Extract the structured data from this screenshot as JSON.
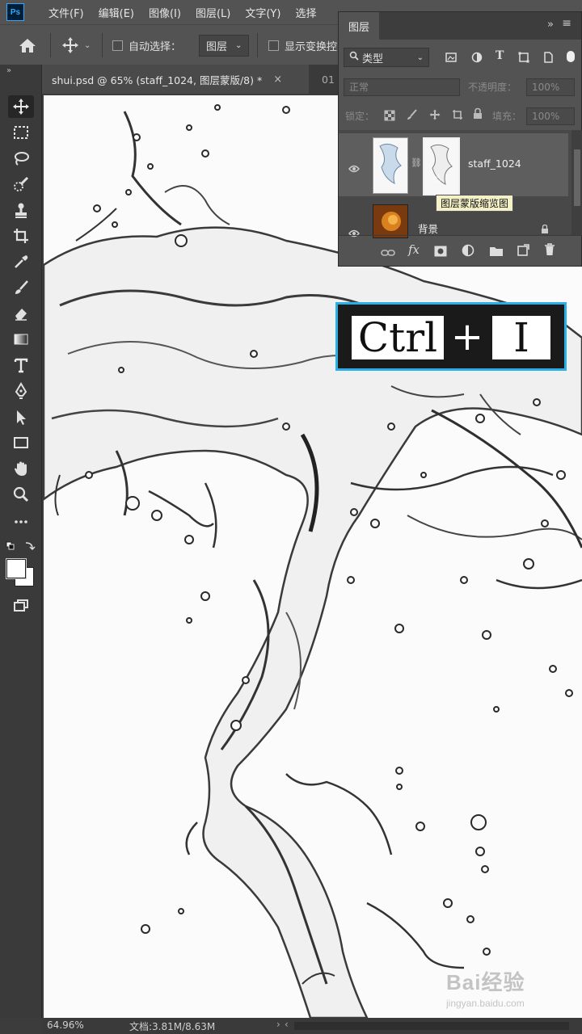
{
  "menubar": {
    "logo": "Ps",
    "items": [
      "文件(F)",
      "编辑(E)",
      "图像(I)",
      "图层(L)",
      "文字(Y)",
      "选择"
    ]
  },
  "options": {
    "auto_select_label": "自动选择：",
    "auto_select_value": "图层",
    "show_transform_label": "显示变换控"
  },
  "tabs": {
    "active_title": "shui.psd @ 65% (staff_1024, 图层蒙版/8) *",
    "close_glyph": "×",
    "second_title": "01"
  },
  "layers_panel": {
    "title": "图层",
    "filter_value": "类型",
    "blend_mode": "正常",
    "opacity_label": "不透明度：",
    "opacity_value": "100%",
    "lock_label": "锁定：",
    "fill_label": "填充：",
    "fill_value": "100%",
    "layers": [
      {
        "name": "staff_1024",
        "visible": true,
        "has_mask": true,
        "selected": true
      },
      {
        "name": "背景",
        "visible": true,
        "locked": true
      }
    ],
    "tooltip": "图层蒙版缩览图",
    "footer_icons": [
      "link-icon",
      "fx-icon",
      "add-mask-icon",
      "adjustment-icon",
      "folder-icon",
      "new-layer-icon",
      "trash-icon"
    ]
  },
  "shortcut_overlay": {
    "key1": "Ctrl",
    "plus": "+",
    "key2": "I",
    "border_color": "#2ab0e6"
  },
  "status": {
    "zoom": "64.96%",
    "doc_info": "文档:3.81M/8.63M"
  },
  "watermark": {
    "brand": "Bai经验",
    "url": "jingyan.baidu.com"
  },
  "toolbar_icons": [
    "move-icon",
    "marquee-icon",
    "lasso-icon",
    "quick-select-icon",
    "stamp-icon",
    "crop-icon",
    "eyedropper-icon",
    "brush-icon",
    "eraser-icon",
    "gradient-icon",
    "type-icon",
    "pen-icon",
    "path-select-icon",
    "rectangle-icon",
    "hand-icon",
    "zoom-icon",
    "more-icon",
    "default-colors-icon",
    "color-swatches",
    "screen-mode-icon"
  ]
}
